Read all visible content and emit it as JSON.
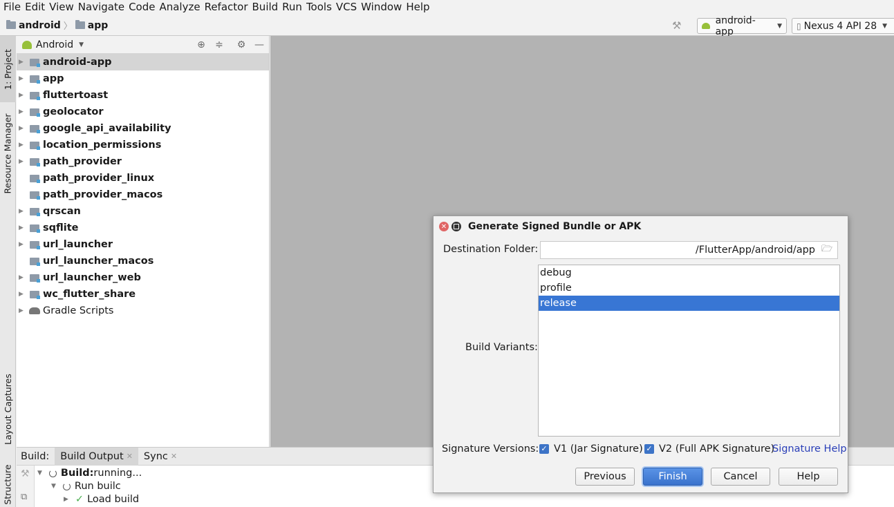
{
  "menu": [
    "File",
    "Edit",
    "View",
    "Navigate",
    "Code",
    "Analyze",
    "Refactor",
    "Build",
    "Run",
    "Tools",
    "VCS",
    "Window",
    "Help"
  ],
  "navbar": {
    "breadcrumbs": [
      "android",
      "app"
    ],
    "run_config": "android-app",
    "device": "Nexus 4 API 28"
  },
  "left_tool_tabs": [
    "1: Project",
    "Resource Manager",
    "Layout Captures",
    "Structure"
  ],
  "project_panel": {
    "view_mode": "Android",
    "tree": [
      {
        "label": "android-app",
        "expandable": true,
        "selected": true
      },
      {
        "label": "app",
        "expandable": true
      },
      {
        "label": "fluttertoast",
        "expandable": true
      },
      {
        "label": "geolocator",
        "expandable": true
      },
      {
        "label": "google_api_availability",
        "expandable": true
      },
      {
        "label": "location_permissions",
        "expandable": true
      },
      {
        "label": "path_provider",
        "expandable": true
      },
      {
        "label": "path_provider_linux",
        "expandable": false
      },
      {
        "label": "path_provider_macos",
        "expandable": false
      },
      {
        "label": "qrscan",
        "expandable": true
      },
      {
        "label": "sqflite",
        "expandable": true
      },
      {
        "label": "url_launcher",
        "expandable": true
      },
      {
        "label": "url_launcher_macos",
        "expandable": false
      },
      {
        "label": "url_launcher_web",
        "expandable": true
      },
      {
        "label": "wc_flutter_share",
        "expandable": true
      },
      {
        "label": "Gradle Scripts",
        "expandable": true,
        "plain": true
      }
    ]
  },
  "build_panel": {
    "label": "Build:",
    "tabs": [
      "Build Output",
      "Sync"
    ],
    "rows": [
      {
        "bold": "Build:",
        "text": " running..."
      },
      {
        "text": "Run builc"
      },
      {
        "text": "Load build"
      }
    ]
  },
  "dialog": {
    "title": "Generate Signed Bundle or APK",
    "destination_label": "Destination Folder:",
    "destination_value": "/FlutterApp/android/app",
    "build_variants_label": "Build Variants:",
    "variants": [
      "debug",
      "profile",
      "release"
    ],
    "selected_variant": "release",
    "signature_label": "Signature Versions:",
    "v1_label": "V1 (Jar Signature)",
    "v2_label": "V2 (Full APK Signature)",
    "signature_help": "Signature Help",
    "buttons": {
      "previous": "Previous",
      "finish": "Finish",
      "cancel": "Cancel",
      "help": "Help"
    }
  },
  "colors": {
    "selection": "#3876d4",
    "link": "#2a3fb8",
    "editor_bg": "#b3b3b3"
  }
}
